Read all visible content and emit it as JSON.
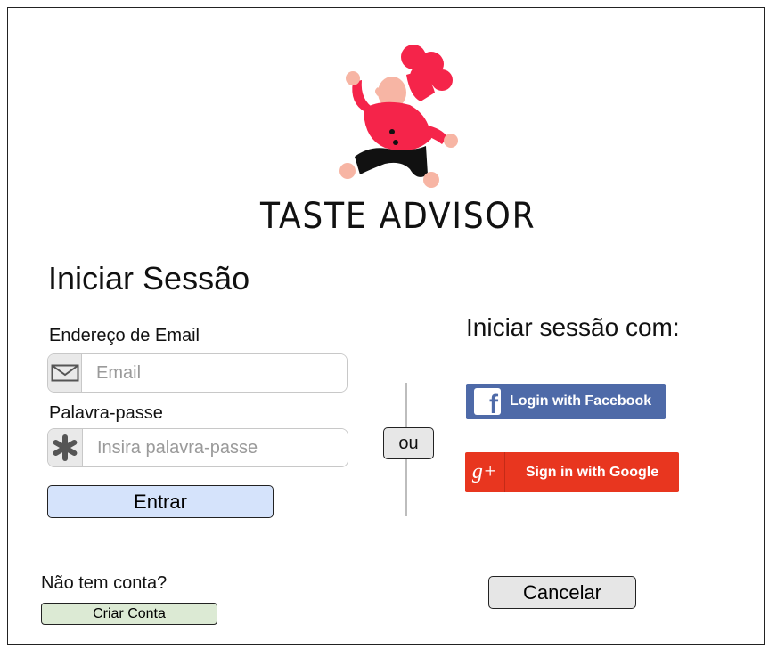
{
  "logo": {
    "text": "TASTE ADVISOR",
    "icon": "chef-icon"
  },
  "login": {
    "title": "Iniciar Sessão",
    "email_label": "Endereço de Email",
    "email_placeholder": "Email",
    "email_icon": "envelope-icon",
    "password_label": "Palavra-passe",
    "password_placeholder": "Insira palavra-passe",
    "password_icon": "asterisk-icon",
    "submit_label": "Entrar"
  },
  "divider": {
    "label": "ou"
  },
  "social": {
    "title": "Iniciar sessão com:",
    "facebook_label": "Login with Facebook",
    "facebook_icon_glyph": "f",
    "google_label": "Sign in with Google",
    "google_icon_glyph": "g+"
  },
  "footer": {
    "no_account_text": "Não tem conta?",
    "create_account_label": "Criar Conta",
    "cancel_label": "Cancelar"
  },
  "colors": {
    "entrar_bg": "#d5e3fb",
    "criar_bg": "#dcead4",
    "facebook": "#4e6aa8",
    "google": "#e8361f",
    "chef_red": "#f5244a",
    "chef_skin": "#f7b5a4"
  }
}
